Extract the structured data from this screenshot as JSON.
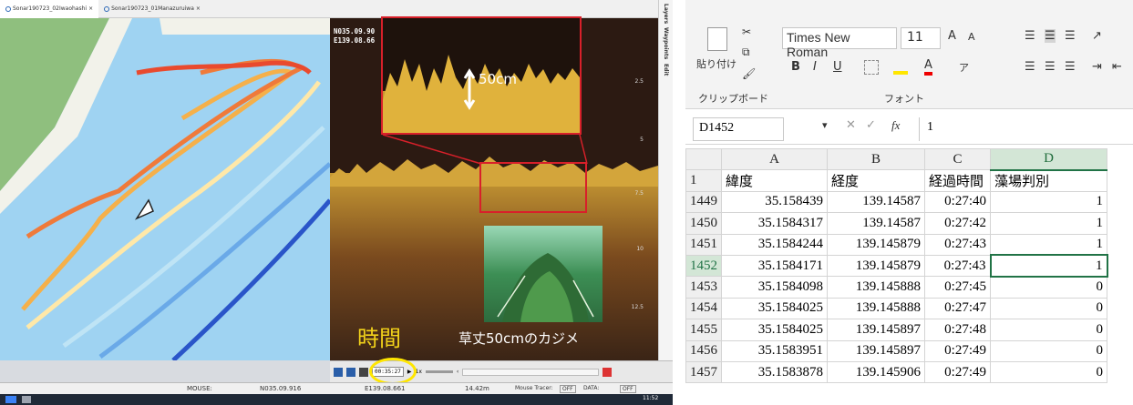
{
  "sonar_app": {
    "tabs": [
      "Sonar190723_02Iwaohashi",
      "Sonar190723_01Manazuruiwa"
    ],
    "tab_close": "×",
    "coords_top": [
      "N035.09.90",
      "E139.08.66"
    ],
    "depth_ticks": [
      "2.5",
      "5",
      "7.5",
      "10",
      "12.5"
    ],
    "side_tabs": [
      "Layers",
      "Waypoints",
      "Edit"
    ],
    "zoom_annotation": "50cm",
    "jikan_label": "時間",
    "photo_caption": "草丈50cmのカジメ",
    "playback_time": "00:35:27",
    "playback_speed": "1x",
    "status": {
      "mouse_label": "MOUSE:",
      "lat": "N035.09.916",
      "lon": "E139.08.661",
      "depth": "14.42m",
      "tracer_label": "Mouse Tracer:",
      "tracer_state": "OFF",
      "data_label": "DATA:",
      "data_state": "OFF"
    },
    "taskbar_time": "11:52"
  },
  "excel": {
    "clipboard": {
      "paste_label": "貼り付け",
      "group_label": "クリップボード"
    },
    "font": {
      "name": "Times New Roman",
      "size": "11",
      "group_label": "フォント",
      "grow": "A",
      "shrink": "A",
      "bold": "B",
      "italic": "I",
      "underline": "U"
    },
    "namebox": "D1452",
    "formula_value": "1",
    "fx_symbol": "fx",
    "columns": [
      "A",
      "B",
      "C",
      "D"
    ],
    "header_row": {
      "num": "1",
      "cells": [
        "緯度",
        "経度",
        "経過時間",
        "藻場判別"
      ]
    },
    "rows": [
      {
        "num": "1449",
        "lat": "35.158439",
        "lon": "139.14587",
        "time": "0:27:40",
        "flag": "1"
      },
      {
        "num": "1450",
        "lat": "35.1584317",
        "lon": "139.14587",
        "time": "0:27:42",
        "flag": "1"
      },
      {
        "num": "1451",
        "lat": "35.1584244",
        "lon": "139.145879",
        "time": "0:27:43",
        "flag": "1"
      },
      {
        "num": "1452",
        "lat": "35.1584171",
        "lon": "139.145879",
        "time": "0:27:43",
        "flag": "1"
      },
      {
        "num": "1453",
        "lat": "35.1584098",
        "lon": "139.145888",
        "time": "0:27:45",
        "flag": "0"
      },
      {
        "num": "1454",
        "lat": "35.1584025",
        "lon": "139.145888",
        "time": "0:27:47",
        "flag": "0"
      },
      {
        "num": "1455",
        "lat": "35.1584025",
        "lon": "139.145897",
        "time": "0:27:48",
        "flag": "0"
      },
      {
        "num": "1456",
        "lat": "35.1583951",
        "lon": "139.145897",
        "time": "0:27:49",
        "flag": "0"
      },
      {
        "num": "1457",
        "lat": "35.1583878",
        "lon": "139.145906",
        "time": "0:27:49",
        "flag": "0"
      }
    ],
    "colors": {
      "accent": "#217346"
    }
  }
}
